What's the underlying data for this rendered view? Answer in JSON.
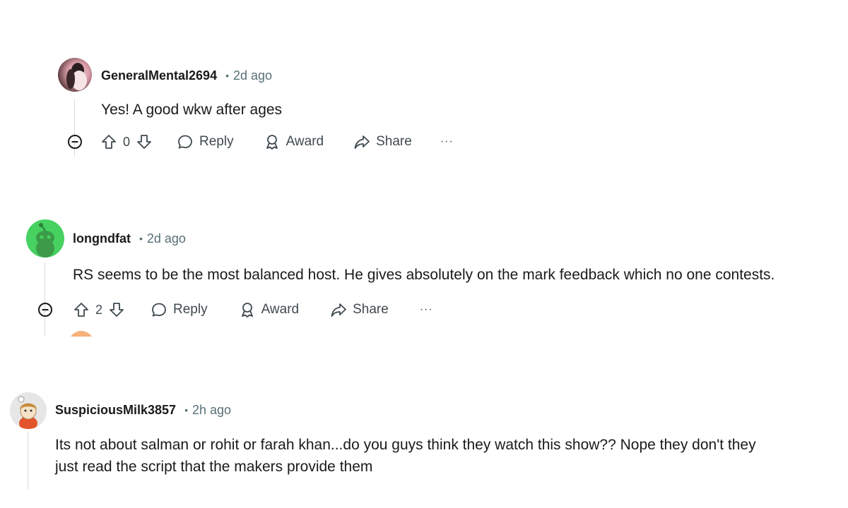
{
  "comments": [
    {
      "username": "GeneralMental2694",
      "separator": "•",
      "time": "2d ago",
      "lines": [
        "Yes! A good wkw after ages"
      ],
      "votes": "0",
      "reply_label": "Reply",
      "award_label": "Award",
      "share_label": "Share",
      "more_label": "···"
    },
    {
      "username": "longndfat",
      "separator": "•",
      "time": "2d ago",
      "lines": [
        "RS seems to be the most balanced host. He gives absolutely on the mark feedback which no one contests."
      ],
      "votes": "2",
      "reply_label": "Reply",
      "award_label": "Award",
      "share_label": "Share",
      "more_label": "···"
    },
    {
      "username": "SuspiciousMilk3857",
      "separator": "•",
      "time": "2h ago",
      "lines": [
        "Its not about salman or rohit or farah khan...do you guys think they watch this show?? Nope they don't they",
        "just read the script that the makers provide them"
      ]
    }
  ],
  "icons": {
    "collapse": "minus-circle-icon",
    "upvote": "arrow-up-icon",
    "downvote": "arrow-down-icon",
    "reply": "speech-bubble-icon",
    "award": "award-ribbon-icon",
    "share": "share-arrow-icon"
  },
  "colors": {
    "text": "#1a1a1b",
    "muted": "#576f76",
    "action": "#3f4a4e",
    "thread_line": "#d7dadc",
    "avatar_green": "#46d160"
  }
}
